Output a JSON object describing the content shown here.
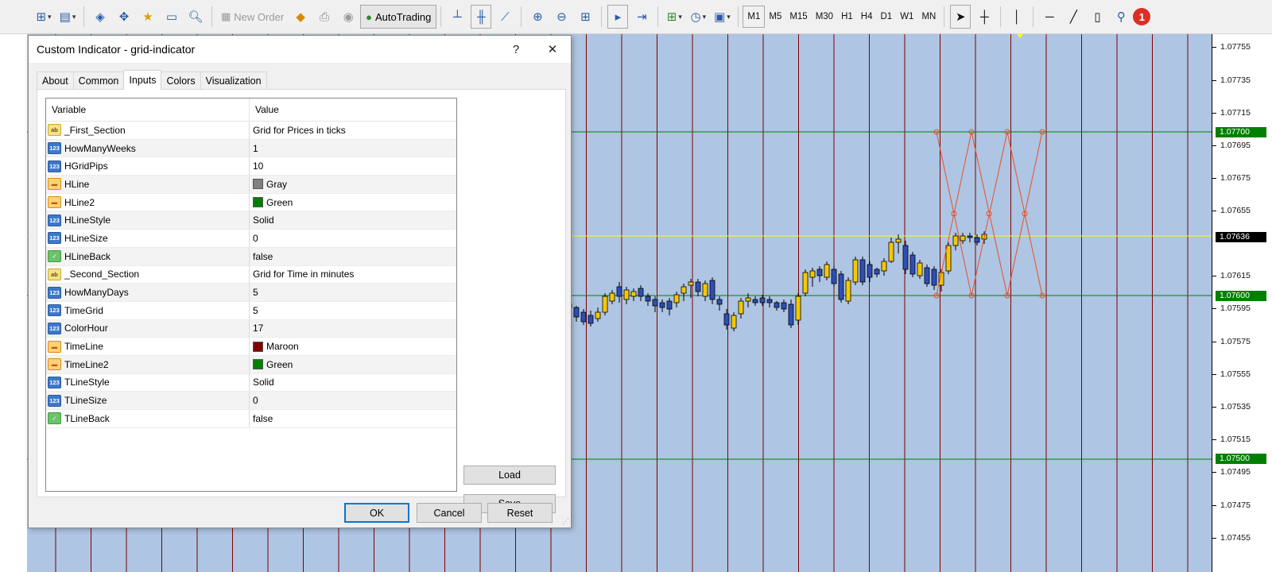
{
  "toolbar": {
    "new_order_label": "New Order",
    "autotrading_label": "AutoTrading",
    "timeframes": [
      "M1",
      "M5",
      "M15",
      "M30",
      "H1",
      "H4",
      "D1",
      "W1",
      "MN"
    ],
    "selected_timeframe": "M1",
    "notification_count": "1"
  },
  "chart": {
    "background": "#aec5e3",
    "price_labels": [
      "1.07755",
      "1.07735",
      "1.07715",
      "1.07695",
      "1.07675",
      "1.07655",
      "1.07615",
      "1.07595",
      "1.07575",
      "1.07555",
      "1.07535",
      "1.07515",
      "1.07495",
      "1.07475",
      "1.07455"
    ],
    "price_tags": [
      {
        "text": "1.07700",
        "color": "#008000"
      },
      {
        "text": "1.07636",
        "color": "#000000"
      },
      {
        "text": "1.07600",
        "color": "#008000"
      },
      {
        "text": "1.07500",
        "color": "#008000"
      }
    ],
    "hline_color": "#008000",
    "current_price_color": "#ffff00",
    "vline_color": "#800000",
    "bull_candle_color": "#f5c800",
    "bear_candle_color": "#2f4fb5"
  },
  "dialog": {
    "title": "Custom Indicator - grid-indicator",
    "help_label": "?",
    "close_label": "✕",
    "tabs": [
      {
        "label": "About",
        "active": false
      },
      {
        "label": "Common",
        "active": false
      },
      {
        "label": "Inputs",
        "active": true
      },
      {
        "label": "Colors",
        "active": false
      },
      {
        "label": "Visualization",
        "active": false
      }
    ],
    "grid_headers": {
      "variable": "Variable",
      "value": "Value"
    },
    "rows": [
      {
        "variable": "_First_Section",
        "type": "string",
        "icon_text": "ab",
        "value": "Grid for Prices in ticks"
      },
      {
        "variable": "HowManyWeeks",
        "type": "int",
        "icon_text": "123",
        "value": "1"
      },
      {
        "variable": "HGridPips",
        "type": "int",
        "icon_text": "123",
        "value": "10"
      },
      {
        "variable": "HLine",
        "type": "color",
        "icon_text": "▬",
        "value": "Gray",
        "swatch": "#808080"
      },
      {
        "variable": "HLine2",
        "type": "color",
        "icon_text": "▬",
        "value": "Green",
        "swatch": "#008000"
      },
      {
        "variable": "HLineStyle",
        "type": "int",
        "icon_text": "123",
        "value": "Solid"
      },
      {
        "variable": "HLineSize",
        "type": "int",
        "icon_text": "123",
        "value": "0"
      },
      {
        "variable": "HLineBack",
        "type": "bool",
        "icon_text": "✓",
        "value": "false"
      },
      {
        "variable": "_Second_Section",
        "type": "string",
        "icon_text": "ab",
        "value": "Grid for Time in minutes"
      },
      {
        "variable": "HowManyDays",
        "type": "int",
        "icon_text": "123",
        "value": "5"
      },
      {
        "variable": "TimeGrid",
        "type": "int",
        "icon_text": "123",
        "value": "5"
      },
      {
        "variable": "ColorHour",
        "type": "int",
        "icon_text": "123",
        "value": "17"
      },
      {
        "variable": "TimeLine",
        "type": "color",
        "icon_text": "▬",
        "value": "Maroon",
        "swatch": "#800000"
      },
      {
        "variable": "TimeLine2",
        "type": "color",
        "icon_text": "▬",
        "value": "Green",
        "swatch": "#008000"
      },
      {
        "variable": "TLineStyle",
        "type": "int",
        "icon_text": "123",
        "value": "Solid"
      },
      {
        "variable": "TLineSize",
        "type": "int",
        "icon_text": "123",
        "value": "0"
      },
      {
        "variable": "TLineBack",
        "type": "bool",
        "icon_text": "✓",
        "value": "false"
      }
    ],
    "load_label": "Load",
    "save_label": "Save",
    "ok_label": "OK",
    "cancel_label": "Cancel",
    "reset_label": "Reset"
  }
}
